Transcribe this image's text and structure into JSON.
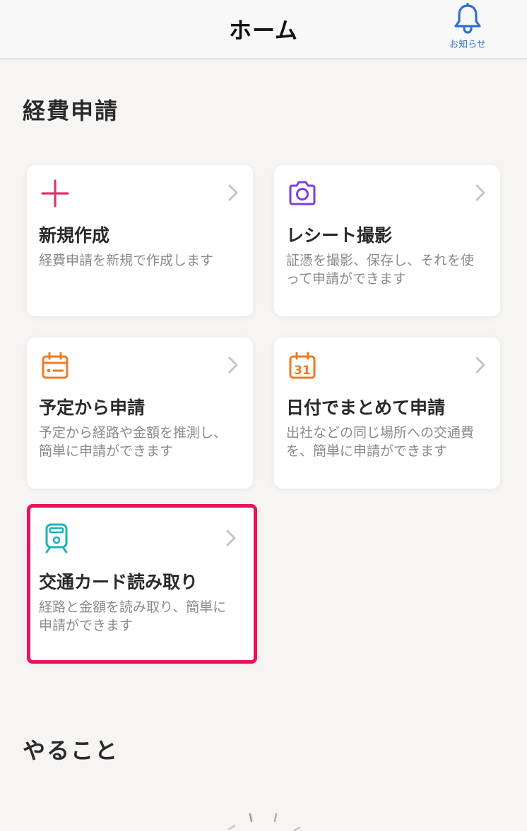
{
  "header": {
    "title": "ホーム",
    "notification_label": "お知らせ"
  },
  "sections": {
    "expense": "経費申請",
    "todo": "やること"
  },
  "cards": [
    {
      "title": "新規作成",
      "description": "経費申請を新規で作成します",
      "icon": "plus-icon"
    },
    {
      "title": "レシート撮影",
      "description": "証憑を撮影、保存し、それを使って申請ができます",
      "icon": "camera-icon"
    },
    {
      "title": "予定から申請",
      "description": "予定から経路や金額を推測し、簡単に申請ができます",
      "icon": "calendar-icon"
    },
    {
      "title": "日付でまとめて申請",
      "description": "出社などの同じ場所への交通費を、簡単に申請ができます",
      "icon": "calendar-date-icon",
      "icon_text": "31"
    },
    {
      "title": "交通カード読み取り",
      "description": "経路と金額を読み取り、簡単に申請ができます",
      "icon": "train-icon",
      "highlighted": true
    }
  ],
  "colors": {
    "accent_pink": "#e0336b",
    "accent_purple": "#7b3fe4",
    "accent_orange": "#f07a22",
    "accent_teal": "#1fb0b8",
    "highlight": "#ec0f5d",
    "link_blue": "#2f6fd6"
  }
}
